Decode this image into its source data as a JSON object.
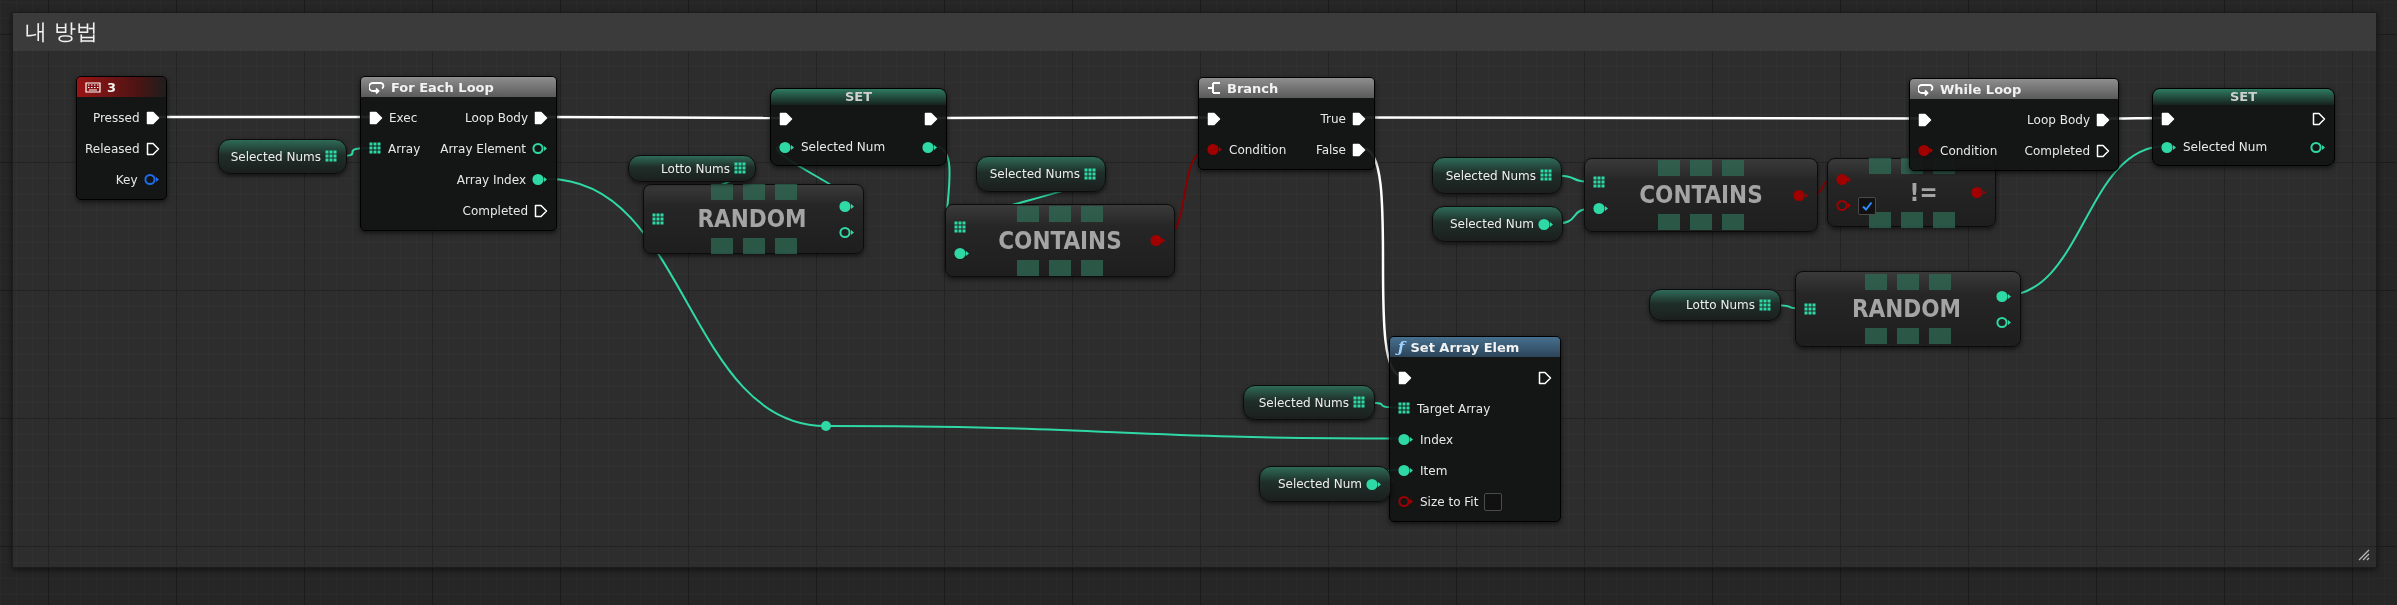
{
  "comment": {
    "title": "내 방법"
  },
  "nodes": [
    {
      "kind": "event",
      "title": "3",
      "outputs": [
        {
          "label": "Pressed",
          "kind": "exec",
          "connected": true
        },
        {
          "label": "Released",
          "kind": "exec",
          "connected": false
        },
        {
          "label": "Key",
          "kind": "key",
          "connected": false
        }
      ]
    },
    {
      "kind": "variable",
      "title": "Selected Nums",
      "outputs": [
        {
          "kind": "int-array",
          "connected": true
        }
      ]
    },
    {
      "kind": "loop",
      "title": "For Each Loop",
      "inputs": [
        {
          "label": "Exec",
          "kind": "exec",
          "connected": true
        },
        {
          "label": "Array",
          "kind": "int-array",
          "connected": true
        }
      ],
      "outputs": [
        {
          "label": "Loop Body",
          "kind": "exec",
          "connected": true
        },
        {
          "label": "Array Element",
          "kind": "int",
          "connected": false
        },
        {
          "label": "Array Index",
          "kind": "int",
          "connected": true
        },
        {
          "label": "Completed",
          "kind": "exec",
          "connected": false
        }
      ]
    },
    {
      "kind": "variable",
      "title": "Lotto Nums",
      "outputs": [
        {
          "kind": "int-array",
          "connected": true
        }
      ]
    },
    {
      "kind": "compact",
      "title": "RANDOM",
      "inputs": [
        {
          "kind": "int-array",
          "connected": true
        }
      ],
      "outputs": [
        {
          "kind": "int",
          "connected": true
        },
        {
          "kind": "int",
          "connected": false
        }
      ]
    },
    {
      "kind": "set",
      "title": "SET",
      "inputs": [
        {
          "kind": "exec",
          "connected": true
        },
        {
          "label": "Selected Num",
          "kind": "int",
          "connected": true
        }
      ],
      "outputs": [
        {
          "kind": "exec",
          "connected": true
        },
        {
          "kind": "int",
          "connected": true
        }
      ]
    },
    {
      "kind": "variable",
      "title": "Selected Nums",
      "outputs": [
        {
          "kind": "int-array",
          "connected": true
        }
      ]
    },
    {
      "kind": "compact",
      "title": "CONTAINS",
      "inputs": [
        {
          "kind": "int-array",
          "connected": true
        },
        {
          "kind": "int",
          "connected": true
        }
      ],
      "outputs": [
        {
          "kind": "bool",
          "connected": true
        }
      ]
    },
    {
      "kind": "branch",
      "title": "Branch",
      "inputs": [
        {
          "kind": "exec",
          "connected": true
        },
        {
          "label": "Condition",
          "kind": "bool",
          "connected": true
        }
      ],
      "outputs": [
        {
          "label": "True",
          "kind": "exec",
          "connected": true
        },
        {
          "label": "False",
          "kind": "exec",
          "connected": true
        }
      ]
    },
    {
      "kind": "variable",
      "title": "Selected Nums",
      "outputs": [
        {
          "kind": "int-array",
          "connected": true
        }
      ]
    },
    {
      "kind": "variable",
      "title": "Selected Num",
      "outputs": [
        {
          "kind": "int",
          "connected": true
        }
      ]
    },
    {
      "kind": "compact",
      "title": "CONTAINS",
      "inputs": [
        {
          "kind": "int-array",
          "connected": true
        },
        {
          "kind": "int",
          "connected": true
        }
      ],
      "outputs": [
        {
          "kind": "bool",
          "connected": true
        }
      ]
    },
    {
      "kind": "compact",
      "title": "!=",
      "inputs": [
        {
          "kind": "bool",
          "connected": true
        },
        {
          "kind": "bool",
          "connected": false,
          "checked": true
        }
      ],
      "outputs": [
        {
          "kind": "bool",
          "connected": true
        }
      ]
    },
    {
      "kind": "loop",
      "title": "While Loop",
      "inputs": [
        {
          "kind": "exec",
          "connected": true
        },
        {
          "label": "Condition",
          "kind": "bool",
          "connected": true
        }
      ],
      "outputs": [
        {
          "label": "Loop Body",
          "kind": "exec",
          "connected": true
        },
        {
          "label": "Completed",
          "kind": "exec",
          "connected": false
        }
      ]
    },
    {
      "kind": "set",
      "title": "SET",
      "inputs": [
        {
          "kind": "exec",
          "connected": true
        },
        {
          "label": "Selected Num",
          "kind": "int",
          "connected": true
        }
      ],
      "outputs": [
        {
          "kind": "exec",
          "connected": false
        },
        {
          "kind": "int",
          "connected": false
        }
      ]
    },
    {
      "kind": "variable",
      "title": "Lotto Nums",
      "outputs": [
        {
          "kind": "int-array",
          "connected": true
        }
      ]
    },
    {
      "kind": "compact",
      "title": "RANDOM",
      "inputs": [
        {
          "kind": "int-array",
          "connected": true
        }
      ],
      "outputs": [
        {
          "kind": "int",
          "connected": true
        },
        {
          "kind": "int",
          "connected": false
        }
      ]
    },
    {
      "kind": "variable",
      "title": "Selected Nums",
      "outputs": [
        {
          "kind": "int-array",
          "connected": true
        }
      ]
    },
    {
      "kind": "variable",
      "title": "Selected Num",
      "outputs": [
        {
          "kind": "int",
          "connected": true
        }
      ]
    },
    {
      "kind": "function",
      "title": "Set Array Elem",
      "glyph": "ƒ",
      "inputs": [
        {
          "kind": "exec",
          "connected": true
        },
        {
          "label": "Target Array",
          "kind": "int-array",
          "connected": true
        },
        {
          "label": "Index",
          "kind": "int",
          "connected": true
        },
        {
          "label": "Item",
          "kind": "int",
          "connected": true
        },
        {
          "label": "Size to Fit",
          "kind": "bool",
          "connected": false,
          "checked": false
        }
      ],
      "outputs": [
        {
          "kind": "exec",
          "connected": false
        }
      ]
    }
  ]
}
